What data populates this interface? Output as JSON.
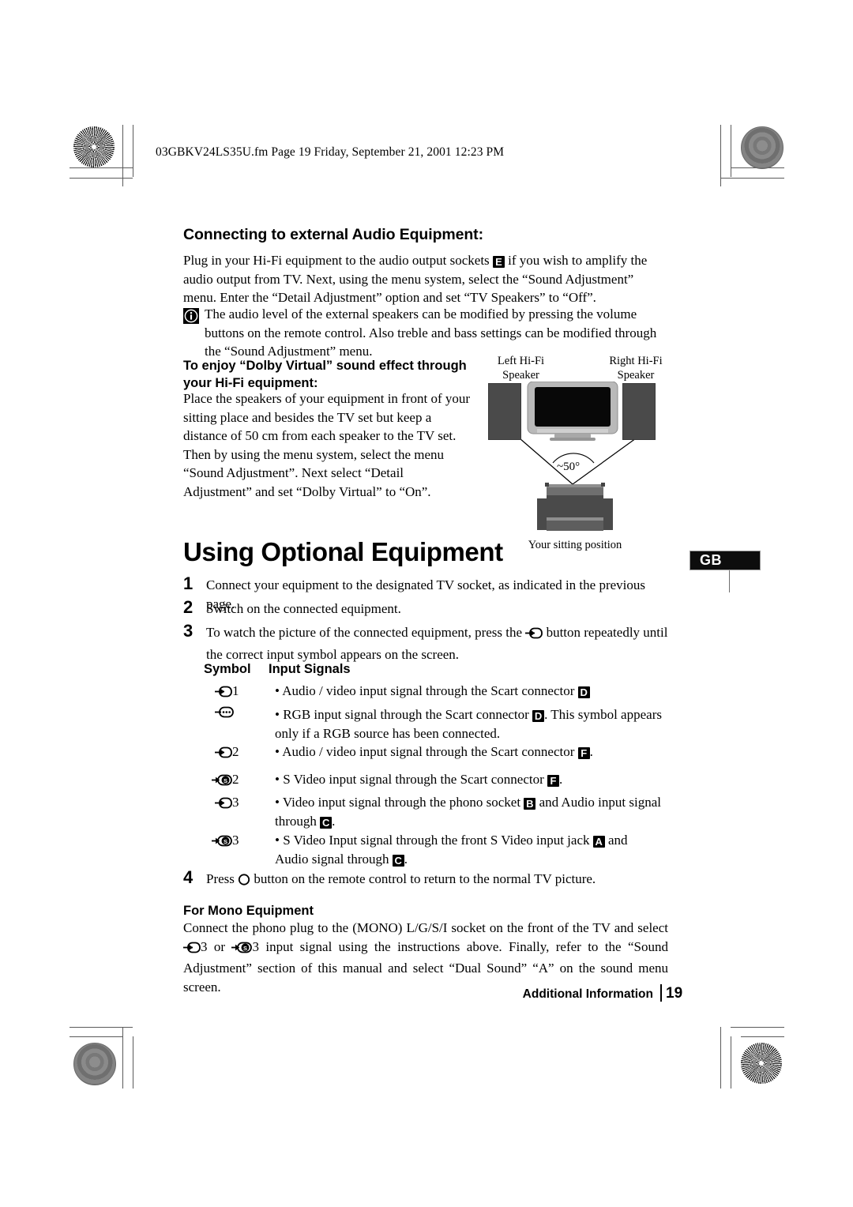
{
  "header": {
    "slug": "03GBKV24LS35U.fm  Page 19  Friday, September 21, 2001  12:23 PM"
  },
  "section_audio": {
    "heading": "Connecting to external Audio Equipment:",
    "para_1_a": "Plug in your Hi-Fi equipment to the audio output sockets",
    "para_1_box": "E",
    "para_1_b": "if you wish to amplify the audio output from TV. Next, using the menu system, select the “Sound Adjustment” menu. Enter the “Detail Adjustment” option and set “TV Speakers” to “Off”.",
    "note_icon": "info-icon",
    "note": "The audio level of the external speakers can be modified by pressing the volume buttons on the remote control. Also treble and bass settings can be modified through the “Sound Adjustment” menu."
  },
  "section_dolby": {
    "heading": "To enjoy “Dolby Virtual” sound effect through your Hi-Fi equipment:",
    "body": "Place the speakers of your equipment in front of your sitting place and besides the TV set but keep a distance of 50 cm from each speaker to the TV set.\nThen by using the menu system, select the menu “Sound Adjustment”. Next select “Detail Adjustment” and set “Dolby Virtual” to “On”."
  },
  "diagram": {
    "left_speaker_label": "Left Hi-Fi\nSpeaker",
    "right_speaker_label": "Right Hi-Fi\nSpeaker",
    "angle_label": "~50°",
    "sitting_label": "Your sitting position"
  },
  "main": {
    "title": "Using Optional Equipment",
    "steps": [
      {
        "num": "1",
        "text": "Connect your equipment to the designated TV socket, as indicated in the previous page."
      },
      {
        "num": "2",
        "text": "Switch on the connected equipment."
      },
      {
        "num": "3",
        "text_a": "To watch the picture of the connected equipment, press the",
        "icon": "input-select-icon",
        "text_b": "button repeatedly until the correct input symbol appears on the screen."
      },
      {
        "num": "4",
        "text_a": "Press",
        "icon": "power-circle-icon",
        "text_b": "button on the remote control to return to the normal TV picture."
      }
    ]
  },
  "table": {
    "col_symbol": "Symbol",
    "col_signals": "Input Signals",
    "rows": [
      {
        "symbol_icon": "input-arrow-icon",
        "symbol_suffix": "1",
        "parts": [
          {
            "t": "text",
            "v": "• Audio / video input signal through the Scart connector "
          },
          {
            "t": "box",
            "v": "D"
          }
        ]
      },
      {
        "symbol_icon": "input-rgb-icon",
        "symbol_suffix": "",
        "parts": [
          {
            "t": "text",
            "v": "• RGB input signal through the Scart connector "
          },
          {
            "t": "box",
            "v": "D"
          },
          {
            "t": "text",
            "v": ". This symbol appears only if a RGB source has been connected."
          }
        ]
      },
      {
        "symbol_icon": "input-arrow-icon",
        "symbol_suffix": "2",
        "parts": [
          {
            "t": "text",
            "v": "• Audio / video input signal through the Scart connector "
          },
          {
            "t": "box",
            "v": "F"
          },
          {
            "t": "text",
            "v": "."
          }
        ]
      },
      {
        "symbol_icon": "input-svideo-icon",
        "symbol_suffix": "2",
        "parts": [
          {
            "t": "text",
            "v": "• S Video input signal through the Scart connector "
          },
          {
            "t": "box",
            "v": "F"
          },
          {
            "t": "text",
            "v": "."
          }
        ]
      },
      {
        "symbol_icon": "input-arrow-icon",
        "symbol_suffix": "3",
        "parts": [
          {
            "t": "text",
            "v": "• Video input signal through the phono socket "
          },
          {
            "t": "box",
            "v": "B"
          },
          {
            "t": "text",
            "v": " and Audio input signal through "
          },
          {
            "t": "box",
            "v": "C"
          },
          {
            "t": "text",
            "v": "."
          }
        ]
      },
      {
        "symbol_icon": "input-svideo-icon",
        "symbol_suffix": "3",
        "parts": [
          {
            "t": "text",
            "v": "• S Video Input signal through the front S Video input jack "
          },
          {
            "t": "box",
            "v": "A"
          },
          {
            "t": "text",
            "v": " and Audio signal through "
          },
          {
            "t": "box",
            "v": "C"
          },
          {
            "t": "text",
            "v": "."
          }
        ]
      }
    ]
  },
  "section_mono": {
    "heading": "For Mono Equipment",
    "parts": [
      {
        "t": "text",
        "v": "Connect the phono plug to the (MONO) L/G/S/I socket on the front of the TV and select "
      },
      {
        "t": "icon",
        "v": "input-arrow-icon"
      },
      {
        "t": "text",
        "v": "3 or "
      },
      {
        "t": "icon",
        "v": "input-svideo-icon"
      },
      {
        "t": "text",
        "v": "3 input signal using the instructions above. Finally, refer to the “Sound Adjustment” section of this manual and select “Dual Sound” “A” on the sound menu screen."
      }
    ]
  },
  "side_tab": {
    "label": "GB"
  },
  "footer": {
    "label": "Additional Information",
    "page": "19"
  },
  "colors": {
    "ink": "#000000",
    "tab_bg": "#0d0d0d",
    "speaker_fill": "#4a4a4a",
    "tv_body": "#b9b9b9",
    "screen": "#080808",
    "mark_gray": "#5a5a5a"
  }
}
